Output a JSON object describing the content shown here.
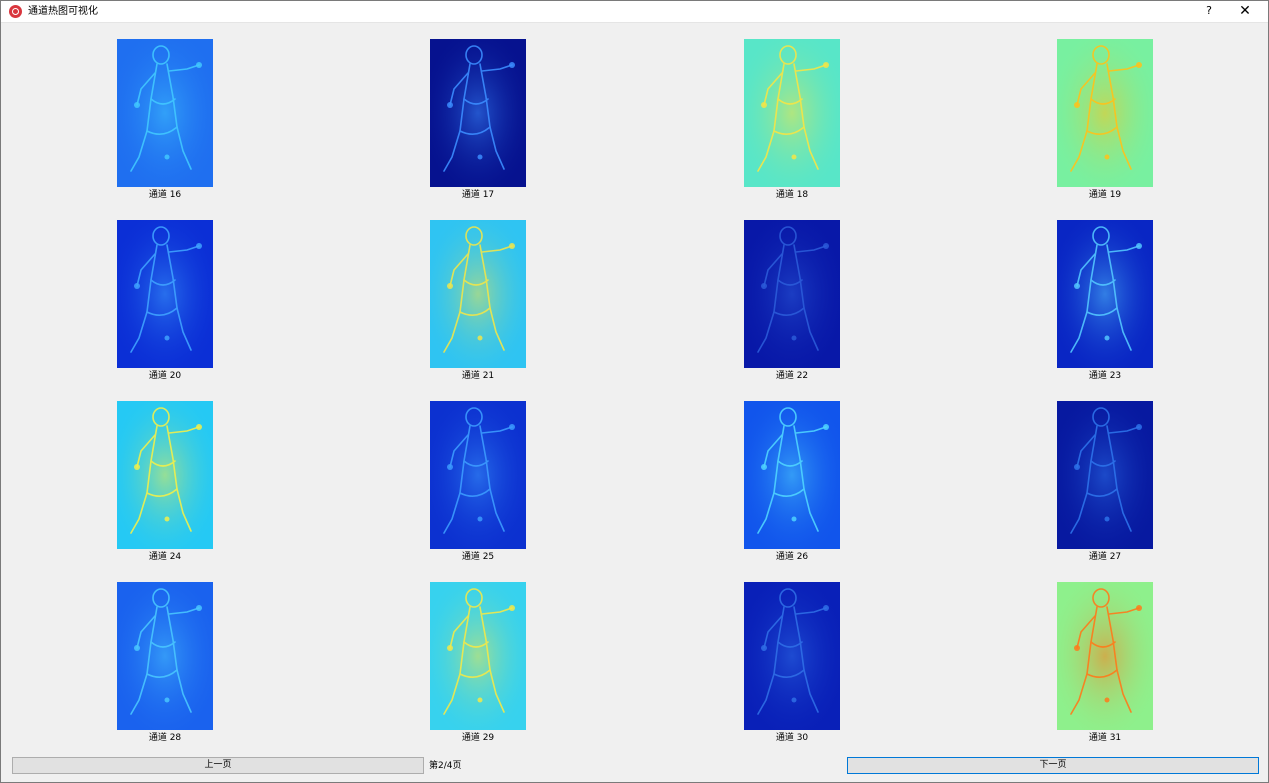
{
  "window": {
    "title": "通道热图可视化",
    "help_label": "?",
    "close_label": "✕"
  },
  "channels": [
    {
      "label": "通道 16",
      "colormap": "jet",
      "base_color": "#1f6ff0",
      "glow_color": "#41c8ff"
    },
    {
      "label": "通道 17",
      "colormap": "jet",
      "base_color": "#06128f",
      "glow_color": "#3b8cff"
    },
    {
      "label": "通道 18",
      "colormap": "jet",
      "base_color": "#58e6c8",
      "glow_color": "#f6e545"
    },
    {
      "label": "通道 19",
      "colormap": "jet",
      "base_color": "#78f0a0",
      "glow_color": "#ffc21a"
    },
    {
      "label": "通道 20",
      "colormap": "jet",
      "base_color": "#0b2fd6",
      "glow_color": "#3fa2ff"
    },
    {
      "label": "通道 21",
      "colormap": "jet",
      "base_color": "#2fc4f2",
      "glow_color": "#f0e64a"
    },
    {
      "label": "通道 22",
      "colormap": "jet",
      "base_color": "#0818a8",
      "glow_color": "#2b5bd9"
    },
    {
      "label": "通道 23",
      "colormap": "jet",
      "base_color": "#0926c4",
      "glow_color": "#53c6ff"
    },
    {
      "label": "通道 24",
      "colormap": "jet",
      "base_color": "#25c9f4",
      "glow_color": "#f2f04a"
    },
    {
      "label": "通道 25",
      "colormap": "jet",
      "base_color": "#0c31d0",
      "glow_color": "#3c9bff"
    },
    {
      "label": "通道 26",
      "colormap": "jet",
      "base_color": "#1155ec",
      "glow_color": "#4fd4ff"
    },
    {
      "label": "通道 27",
      "colormap": "jet",
      "base_color": "#0719a0",
      "glow_color": "#2d72ea"
    },
    {
      "label": "通道 28",
      "colormap": "jet",
      "base_color": "#1a62ee",
      "glow_color": "#49c6ff"
    },
    {
      "label": "通道 29",
      "colormap": "jet",
      "base_color": "#37d2ee",
      "glow_color": "#f3e948"
    },
    {
      "label": "通道 30",
      "colormap": "jet",
      "base_color": "#0920b8",
      "glow_color": "#2f6ee6"
    },
    {
      "label": "通道 31",
      "colormap": "jet",
      "base_color": "#8ef08c",
      "glow_color": "#ff7a1a"
    }
  ],
  "pagination": {
    "prev_label": "上一页",
    "next_label": "下一页",
    "page_text": "第2/4页"
  }
}
